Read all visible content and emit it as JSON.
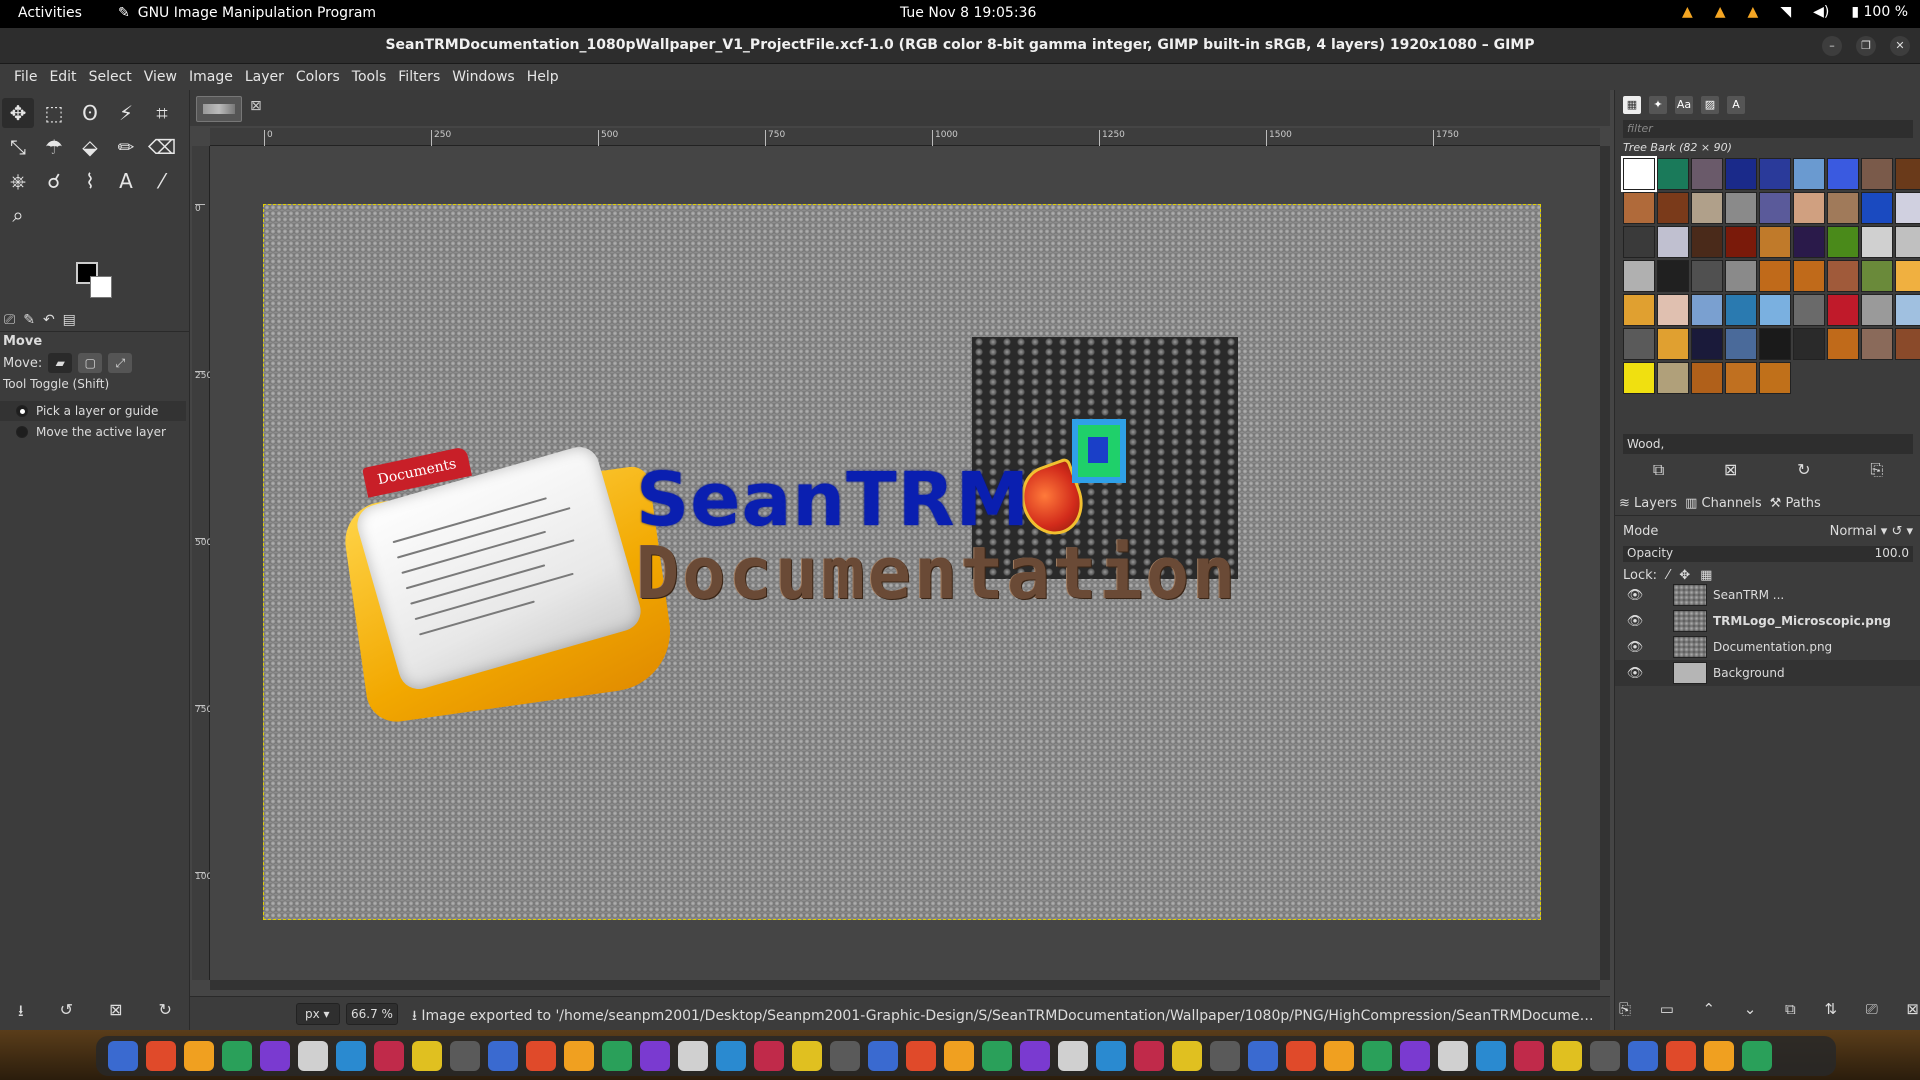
{
  "topbar": {
    "activities": "Activities",
    "app_name": "GNU Image Manipulation Program",
    "clock": "Tue Nov 8  19:05:36",
    "battery": "100 %"
  },
  "window": {
    "title": "SeanTRMDocumentation_1080pWallpaper_V1_ProjectFile.xcf-1.0 (RGB color 8-bit gamma integer, GIMP built-in sRGB, 4 layers) 1920x1080 – GIMP"
  },
  "menubar": [
    "File",
    "Edit",
    "Select",
    "View",
    "Image",
    "Layer",
    "Colors",
    "Tools",
    "Filters",
    "Windows",
    "Help"
  ],
  "tool_options": {
    "title": "Move",
    "move_label": "Move:",
    "toggle_label": "Tool Toggle  (Shift)",
    "options": [
      "Pick a layer or guide",
      "Move the active layer"
    ],
    "selected_option": 0
  },
  "rulers": {
    "h_ticks": [
      "0",
      "250",
      "500",
      "750",
      "1000",
      "1250",
      "1500",
      "1750"
    ],
    "v_ticks": [
      "0",
      "250",
      "500",
      "750",
      "1000"
    ]
  },
  "canvas_image": {
    "folder_tab_text": "Documents",
    "word1": "SeanTRM",
    "word2": "Documentation"
  },
  "statusbar": {
    "unit": "px",
    "zoom": "66.7 %",
    "message": "Image exported to '/home/seanpm2001/Desktop/Seanpm2001-Graphic-Design/S/SeanTRMDocumentation/Wallpaper/1080p/PNG/HighCompression/SeanTRMDocumentation..."
  },
  "patterns": {
    "filter_placeholder": "filter",
    "selected_name": "Tree Bark (82 × 90)",
    "tag": "Wood,",
    "swatches": [
      "#ffffff",
      "#1a7a5a",
      "#6a5a6a",
      "#1a2a8a",
      "#2a3a9a",
      "#6a9ad0",
      "#3a5ae0",
      "#7a5a4a",
      "#6a3a1a",
      "#b06a3a",
      "#7a3a1a",
      "#b0a08a",
      "#8a8a8a",
      "#5a5a9a",
      "#d0a080",
      "#a07a5a",
      "#1a4ac0",
      "#d0d0e0",
      "#3a3a3a",
      "#c0c0d0",
      "#4a2a1a",
      "#7a1a0a",
      "#c07a2a",
      "#2a1a4a",
      "#4a8a1a",
      "#d0d0d0",
      "#c0c0c0",
      "#b0b0b0",
      "#202020",
      "#505050",
      "#8a8a8a",
      "#c06a1a",
      "#c06a1a",
      "#a05a3a",
      "#6a8a3a",
      "#f0b040",
      "#e0a030",
      "#e0c0b0",
      "#7aa0d0",
      "#2a7ab0",
      "#7ab0e0",
      "#6a6a6a",
      "#c01a2a",
      "#9a9a9a",
      "#a0c0e0",
      "#5a5a5a",
      "#e0a030",
      "#1a1a3a",
      "#4a6a9a",
      "#1a1a1a",
      "#2a2a2a",
      "#c06a1a",
      "#8a6a5a",
      "#8a4a2a",
      "#f0e010",
      "#b0a07a",
      "#b0601a",
      "#c07020",
      "#c0701a"
    ]
  },
  "layers_panel": {
    "tabs": [
      "Layers",
      "Channels",
      "Paths"
    ],
    "mode_label": "Mode",
    "mode_value": "Normal",
    "opacity_label": "Opacity",
    "opacity_value": "100.0",
    "lock_label": "Lock:",
    "layers": [
      {
        "name": "SeanTRM ...",
        "bold": false
      },
      {
        "name": "TRMLogo_Microscopic.png",
        "bold": true
      },
      {
        "name": "Documentation.png",
        "bold": false
      },
      {
        "name": "Background",
        "bold": false
      }
    ]
  }
}
